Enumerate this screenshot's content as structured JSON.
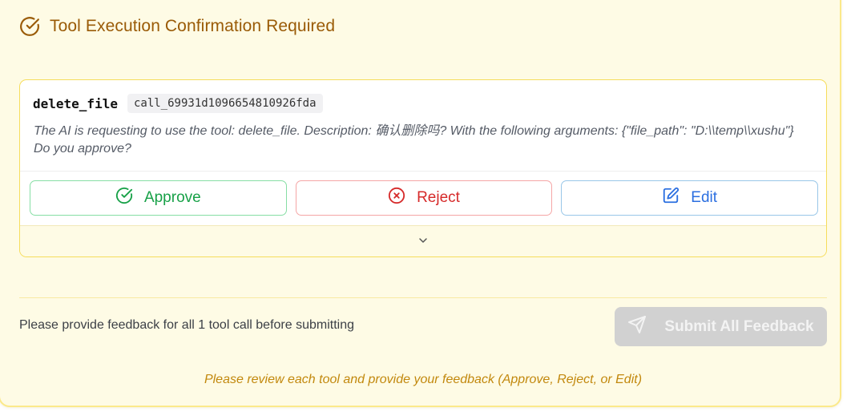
{
  "header": {
    "title": "Tool Execution Confirmation Required",
    "icon": "check-circle-icon"
  },
  "tool_call": {
    "name": "delete_file",
    "call_id": "call_69931d1096654810926fda",
    "description": "The AI is requesting to use the tool: delete_file. Description: 确认删除吗?   With the following arguments: {\"file_path\": \"D:\\\\temp\\\\xushu\"} Do you approve?"
  },
  "actions": {
    "approve_label": "Approve",
    "reject_label": "Reject",
    "edit_label": "Edit"
  },
  "feedback": {
    "status_text": "Please provide feedback for all 1 tool call before submitting",
    "submit_label": "Submit All Feedback",
    "submit_enabled": false
  },
  "footer": {
    "note": "Please review each tool and provide your feedback (Approve, Reject, or Edit)"
  },
  "colors": {
    "panel_bg": "#fefbe5",
    "panel_border": "#fbe98a",
    "title": "#9a5b07",
    "approve": "#18a148",
    "reject": "#d62a2a",
    "edit": "#2b6fe0",
    "submit_disabled": "#d1d1d1",
    "note": "#c2880d"
  }
}
